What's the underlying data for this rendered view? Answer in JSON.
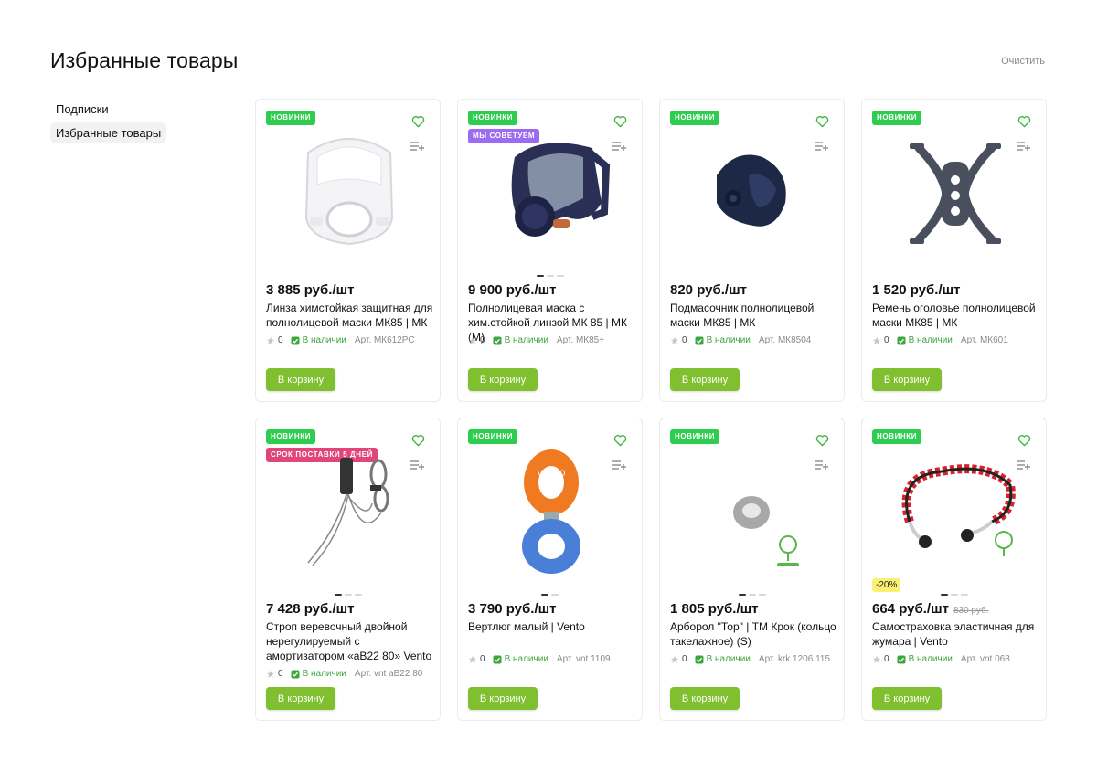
{
  "page": {
    "title": "Избранные товары",
    "clear_label": "Очистить"
  },
  "sidebar": {
    "items": [
      {
        "label": "Подписки"
      },
      {
        "label": "Избранные товары"
      }
    ]
  },
  "colors": {
    "accent": "#7fbf30",
    "badge_new": "#2ecc4f",
    "badge_recommend": "#9b6bf2",
    "badge_delivery": "#e0467a",
    "in_stock": "#3da63d",
    "discount": "#fbef74"
  },
  "cart_label": "В корзину",
  "products": [
    {
      "badges": [
        "НОВИНКИ"
      ],
      "price": "3 885 руб./шт",
      "old_price": "",
      "discount": "",
      "name": "Линза химстойкая защитная для полнолицевой маски МК85 | МК",
      "rating": "0",
      "stock": "В наличии",
      "article": "Арт. МК612РС",
      "image": "face-lens-icon",
      "slides": 0
    },
    {
      "badges": [
        "НОВИНКИ",
        "МЫ СОВЕТУЕМ"
      ],
      "price": "9 900 руб./шт",
      "old_price": "",
      "discount": "",
      "name": "Полнолицевая маска с хим.стойкой линзой МК 85 | МК (М)",
      "rating": "0",
      "stock": "В наличии",
      "article": "Арт. МК85+",
      "image": "full-face-mask-icon",
      "slides": 3
    },
    {
      "badges": [
        "НОВИНКИ"
      ],
      "price": "820 руб./шт",
      "old_price": "",
      "discount": "",
      "name": "Подмасочник полнолицевой маски МК85 | МК",
      "rating": "0",
      "stock": "В наличии",
      "article": "Арт. МК8504",
      "image": "inner-mask-icon",
      "slides": 0
    },
    {
      "badges": [
        "НОВИНКИ"
      ],
      "price": "1 520 руб./шт",
      "old_price": "",
      "discount": "",
      "name": "Ремень оголовье полнолицевой маски МК85 | МК",
      "rating": "0",
      "stock": "В наличии",
      "article": "Арт. МК601",
      "image": "head-harness-icon",
      "slides": 0
    },
    {
      "badges": [
        "НОВИНКИ",
        "СРОК ПОСТАВКИ 5 ДНЕЙ"
      ],
      "price": "7 428 руб./шт",
      "old_price": "",
      "discount": "",
      "name": "Строп веревочный двойной нерегулируемый с амортизатором «аВ22 80» Vento",
      "rating": "0",
      "stock": "В наличии",
      "article": "Арт.  vnt аВ22 80",
      "image": "lanyard-icon",
      "slides": 3
    },
    {
      "badges": [
        "НОВИНКИ"
      ],
      "price": "3 790 руб./шт",
      "old_price": "",
      "discount": "",
      "name": "Вертлюг малый | Vento",
      "rating": "0",
      "stock": "В наличии",
      "article": "Арт. vnt 1109",
      "image": "swivel-icon",
      "slides": 2
    },
    {
      "badges": [
        "НОВИНКИ"
      ],
      "price": "1 805 руб./шт",
      "old_price": "",
      "discount": "",
      "name": "Арборол \"Тор\" | ТМ Крок (кольцо такелажное) (S)",
      "rating": "0",
      "stock": "В наличии",
      "article": "Арт. krk 1206.115",
      "image": "ring-icon",
      "slides": 3
    },
    {
      "badges": [
        "НОВИНКИ"
      ],
      "price": "664 руб./шт",
      "old_price": "830 руб.",
      "discount": "-20%",
      "name": "Самостраховка эластичная для жумара | Vento",
      "rating": "0",
      "stock": "В наличии",
      "article": "Арт. vnt 068",
      "image": "elastic-lanyard-icon",
      "slides": 3
    }
  ]
}
